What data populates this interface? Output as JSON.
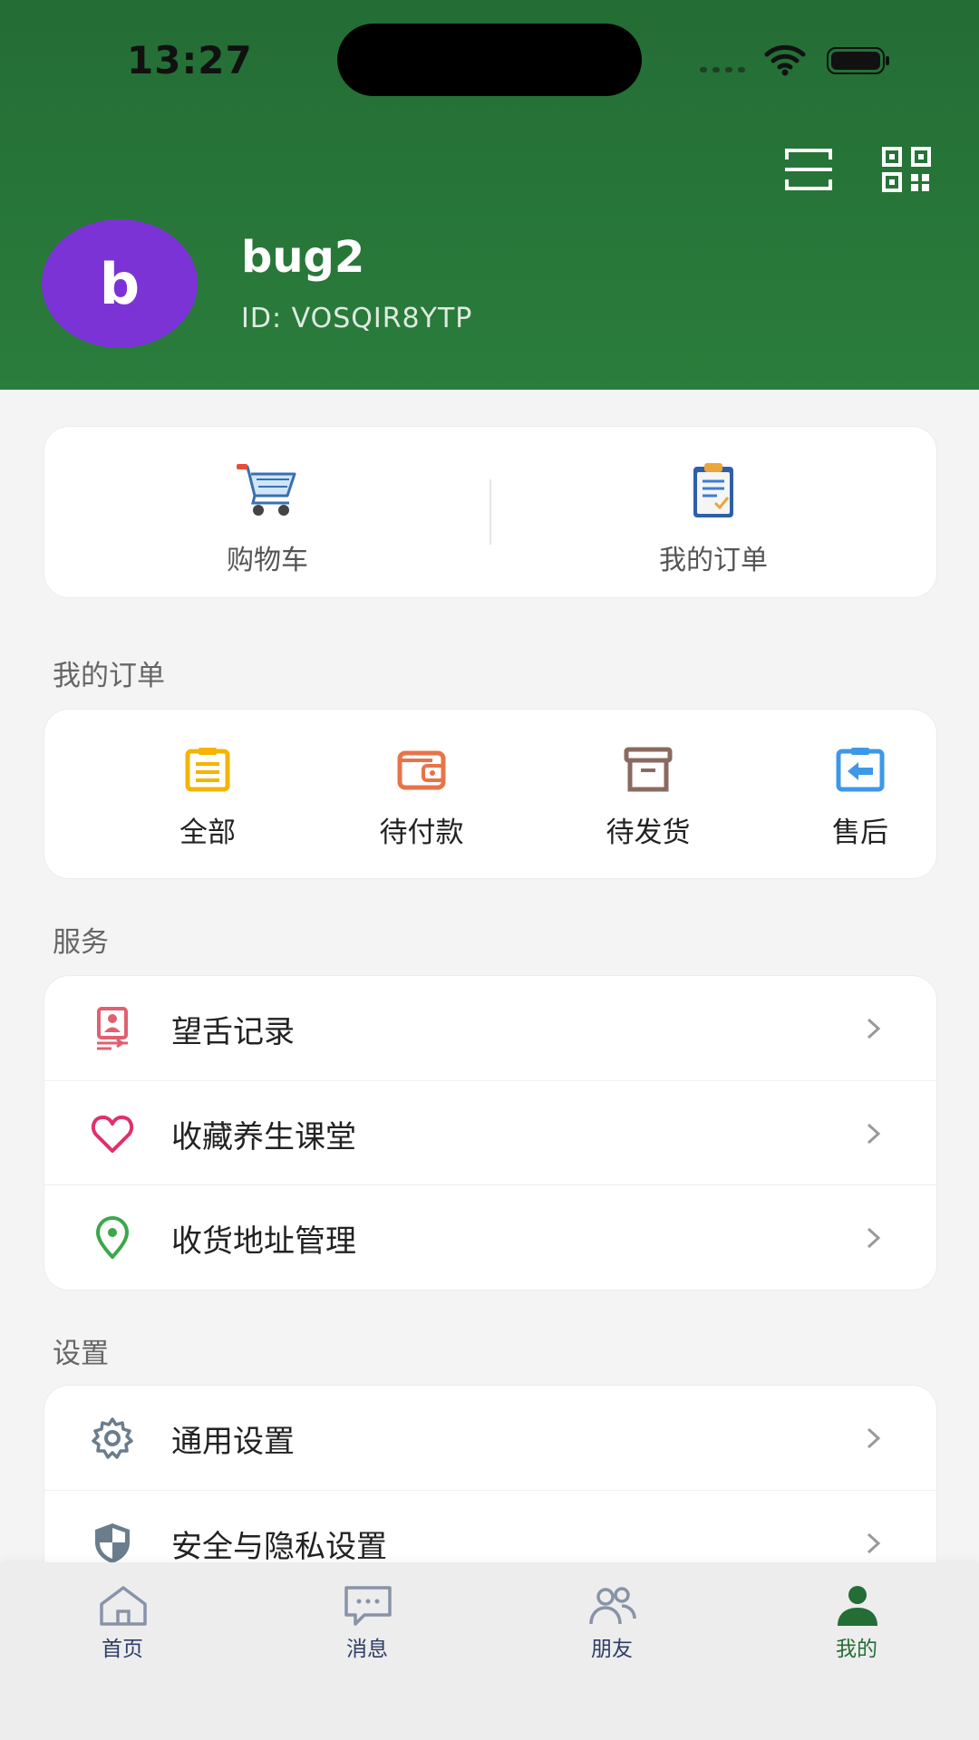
{
  "status_bar": {
    "time": "13:27"
  },
  "profile": {
    "avatar_letter": "b",
    "name": "bug2",
    "id_text": "ID: VOSQIR8YTP"
  },
  "quick_actions": [
    {
      "label": "购物车",
      "icon": "shopping-cart-icon"
    },
    {
      "label": "我的订单",
      "icon": "clipboard-icon"
    }
  ],
  "orders_section": {
    "title": "我的订单",
    "items": [
      {
        "label": "全部",
        "icon": "clipboard-list-icon",
        "color": "#f5b400"
      },
      {
        "label": "待付款",
        "icon": "wallet-icon",
        "color": "#e8734a"
      },
      {
        "label": "待发货",
        "icon": "archive-box-icon",
        "color": "#8a6a60"
      },
      {
        "label": "售后",
        "icon": "return-icon",
        "color": "#3d98e8"
      }
    ]
  },
  "services_section": {
    "title": "服务",
    "items": [
      {
        "label": "望舌记录",
        "icon": "record-icon",
        "color": "#e06070"
      },
      {
        "label": "收藏养生课堂",
        "icon": "heart-icon",
        "color": "#e0306a"
      },
      {
        "label": "收货地址管理",
        "icon": "location-pin-icon",
        "color": "#3aa84a"
      }
    ]
  },
  "settings_section": {
    "title": "设置",
    "items": [
      {
        "label": "通用设置",
        "icon": "gear-icon",
        "color": "#6a7d8c"
      },
      {
        "label": "安全与隐私设置",
        "icon": "shield-icon",
        "color": "#6a7d8c"
      }
    ]
  },
  "tab_bar": [
    {
      "label": "首页",
      "icon": "home-icon"
    },
    {
      "label": "消息",
      "icon": "message-icon"
    },
    {
      "label": "朋友",
      "icon": "friends-icon"
    },
    {
      "label": "我的",
      "icon": "person-icon",
      "active": true
    }
  ],
  "colors": {
    "header_green": "#246d35",
    "avatar_purple": "#7b33d6",
    "active_tab": "#246d35"
  }
}
